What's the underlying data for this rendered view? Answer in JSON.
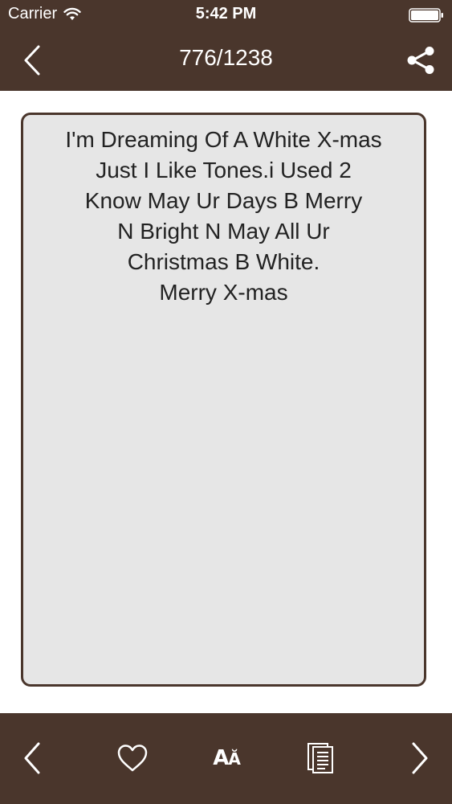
{
  "status_bar": {
    "carrier": "Carrier",
    "time": "5:42 PM"
  },
  "nav": {
    "title": "776/1238",
    "back_icon": "chevron-left-icon",
    "share_icon": "share-icon"
  },
  "message": {
    "text": "I'm Dreaming Of A White X-mas\nJust I Like Tones.i Used 2\nKnow May Ur Days B Merry\nN Bright N May All Ur\nChristmas B White.\nMerry X-mas"
  },
  "toolbar": {
    "font_glyph_big": "A",
    "font_glyph_small": "Ă",
    "items": [
      "previous-icon",
      "heart-icon",
      "font-size-icon",
      "copy-icon",
      "next-icon"
    ]
  },
  "colors": {
    "bar": "#4a362c",
    "card_bg": "#e6e6e6",
    "text": "#222222",
    "icon": "#ffffff"
  }
}
